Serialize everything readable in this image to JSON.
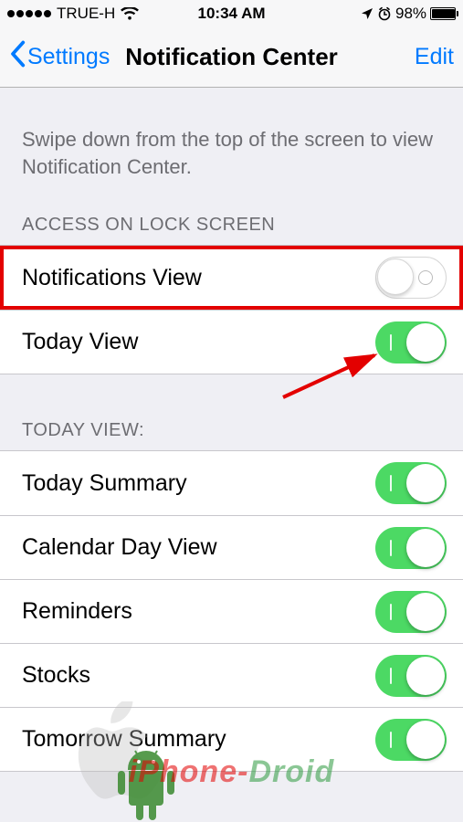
{
  "statusBar": {
    "carrier": "TRUE-H",
    "time": "10:34 AM",
    "batteryPercent": "98%"
  },
  "nav": {
    "back": "Settings",
    "title": "Notification Center",
    "edit": "Edit"
  },
  "description": "Swipe down from the top of the screen to view Notification Center.",
  "sections": {
    "lockScreen": {
      "header": "ACCESS ON LOCK SCREEN",
      "rows": [
        {
          "label": "Notifications View",
          "on": false,
          "highlight": true
        },
        {
          "label": "Today View",
          "on": true,
          "highlight": false
        }
      ]
    },
    "todayView": {
      "header": "TODAY VIEW:",
      "rows": [
        {
          "label": "Today Summary",
          "on": true
        },
        {
          "label": "Calendar Day View",
          "on": true
        },
        {
          "label": "Reminders",
          "on": true
        },
        {
          "label": "Stocks",
          "on": true
        },
        {
          "label": "Tomorrow Summary",
          "on": true
        }
      ]
    }
  },
  "watermark": {
    "part1": "iPhone-",
    "part2": "Droid"
  }
}
